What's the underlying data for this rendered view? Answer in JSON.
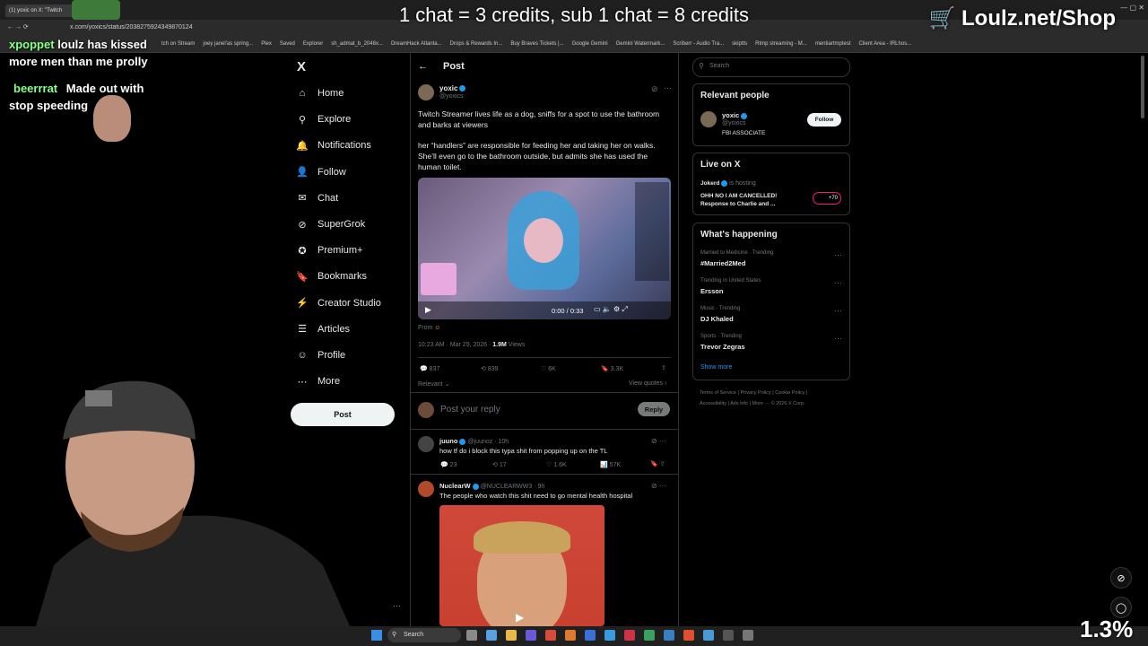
{
  "browser": {
    "tab_title": "(1) yoxic on X: \"Twitch",
    "url": "x.com/yoxics/status/2038275924349870124",
    "bookmarks": [
      "tch on Stream",
      "joey janel'as spring...",
      "Plex",
      "Saved",
      "Explorer",
      "sh_admat_b_2048x...",
      "DreamHack Atlanta...",
      "Drops & Rewards In...",
      "Buy Braves Tickets |...",
      "Google Gemini",
      "Gemini Watermark...",
      "Scriberr - Audio Tra...",
      "skiptts",
      "Rtmp streaming - M...",
      "mentiartmptest",
      "Client Area - IRLhos..."
    ]
  },
  "stream": {
    "banner": "1 chat = 3 credits, sub 1 chat = 8 credits",
    "shop": "Loulz.net/Shop",
    "percent": "1.3%",
    "chat": [
      {
        "user": "xpoppet",
        "text": "loulz has kissed"
      },
      {
        "user": "",
        "text": "more men than me prolly"
      },
      {
        "user": "beerrrat",
        "text": "Made out with"
      },
      {
        "user": "",
        "text": "stop speeding"
      }
    ]
  },
  "nav": {
    "logo": "X",
    "items": [
      {
        "label": "Home",
        "icon": "home-icon"
      },
      {
        "label": "Explore",
        "icon": "search-icon"
      },
      {
        "label": "Notifications",
        "icon": "bell-icon"
      },
      {
        "label": "Follow",
        "icon": "follow-icon"
      },
      {
        "label": "Chat",
        "icon": "mail-icon"
      },
      {
        "label": "SuperGrok",
        "icon": "grok-icon"
      },
      {
        "label": "Premium+",
        "icon": "premium-icon"
      },
      {
        "label": "Bookmarks",
        "icon": "bookmark-icon"
      },
      {
        "label": "Creator Studio",
        "icon": "studio-icon"
      },
      {
        "label": "Articles",
        "icon": "article-icon"
      },
      {
        "label": "Profile",
        "icon": "profile-icon"
      },
      {
        "label": "More",
        "icon": "more-icon"
      }
    ],
    "post_button": "Post"
  },
  "header": {
    "title": "Post"
  },
  "post": {
    "name": "yoxic",
    "handle": "@yoxics",
    "text1": "Twitch Streamer lives life as a dog, sniffs for a spot to use the bathroom and barks at viewers",
    "text2": "her “handlers” are responsible for feeding her and taking her on walks. She’ll even go to the bathroom outside, but admits she has used the human toilet.",
    "video_time": "0:00 / 0:33",
    "from": "From",
    "time": "10:23 AM · Mar 29, 2026 ·",
    "views": "1.9M",
    "views_label": "Views",
    "replies": "837",
    "reposts": "839",
    "likes": "6K",
    "bookmarks": "3.3K",
    "relevant": "Relevant",
    "view_quotes": "View quotes"
  },
  "reply_box": {
    "placeholder": "Post your reply",
    "button": "Reply"
  },
  "replies": [
    {
      "name": "juuno",
      "handle": "@juunoz · 10h",
      "text": "how tf do i block this typa shit from popping up on the TL",
      "replies": "23",
      "reposts": "17",
      "likes": "1.6K",
      "views": "57K"
    },
    {
      "name": "NuclearW",
      "handle": "@NUCLEARWW3 · 9h",
      "text": "The people who watch this shit need to go mental health hospital"
    }
  ],
  "sidebar": {
    "search_placeholder": "Search",
    "relevant": {
      "title": "Relevant people",
      "name": "yoxic",
      "handle": "@yoxics",
      "bio": "FBI ASSOCIATE",
      "follow": "Follow"
    },
    "live": {
      "title": "Live on X",
      "host": "Jokerd",
      "hosting": "is hosting",
      "text": "OHH NO I AM CANCELLED! Response to Charlie and ...",
      "count": "+70"
    },
    "happening": {
      "title": "What's happening",
      "trends": [
        {
          "category": "Married to Medicine · Trending",
          "name": "#Married2Med"
        },
        {
          "category": "Trending in United States",
          "name": "Ersson"
        },
        {
          "category": "Music · Trending",
          "name": "DJ Khaled"
        },
        {
          "category": "Sports · Trending",
          "name": "Trevor Zegras"
        }
      ],
      "show_more": "Show more"
    },
    "footer": [
      "Terms of Service",
      "Privacy Policy",
      "Cookie Policy",
      "Accessibility",
      "Ads info",
      "More ···",
      "© 2026 X Corp."
    ]
  },
  "taskbar": {
    "search": "Search"
  }
}
